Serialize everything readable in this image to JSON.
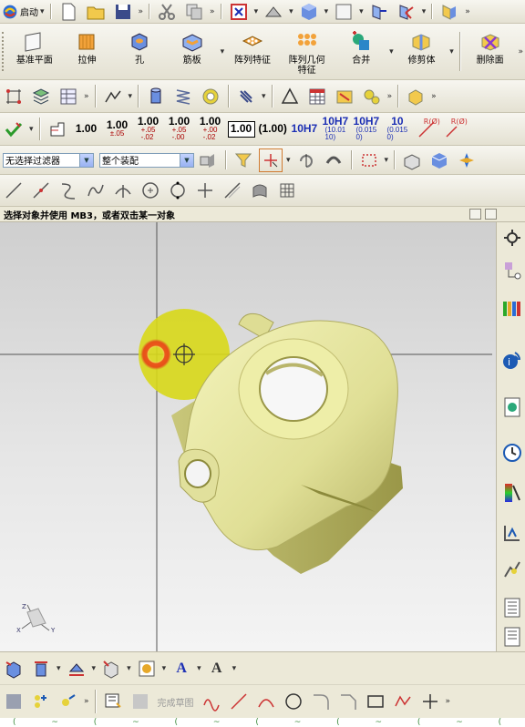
{
  "toolbar1": {
    "start_label": "启动"
  },
  "features": [
    {
      "id": "datum-plane",
      "label": "基准平面"
    },
    {
      "id": "extrude",
      "label": "拉伸"
    },
    {
      "id": "hole",
      "label": "孔"
    },
    {
      "id": "rib",
      "label": "筋板"
    },
    {
      "id": "pattern-feature",
      "label": "阵列特征"
    },
    {
      "id": "pattern-geometry",
      "label": "阵列几何\n特征"
    },
    {
      "id": "unite",
      "label": "合并"
    },
    {
      "id": "trim-body",
      "label": "修剪体"
    },
    {
      "id": "delete-face",
      "label": "删除面"
    }
  ],
  "dimension_row": {
    "items": [
      {
        "main": "1.00",
        "sub": ""
      },
      {
        "main": "1.00",
        "sub": "±.05"
      },
      {
        "main": "1.00",
        "sub": "+.05\n-.02"
      },
      {
        "main": "1.00",
        "sub": "+.05\n-.00"
      },
      {
        "main": "1.00",
        "sub": "+.00\n-.02"
      }
    ],
    "boxed": "1.00",
    "paren": "(1.00)",
    "fit1": "10H7",
    "fit2_main": "10H7",
    "fit2_sub": "(10.01\n10)",
    "fit3_main": "10H7",
    "fit3_sub": "(0.015\n0)",
    "fit4_main": "10",
    "fit4_sub": "(0.015\n0)",
    "r1": "R(Ø)",
    "r2": "R(Ø)"
  },
  "selection": {
    "filter_value": "无选择过滤器",
    "scope_value": "整个装配"
  },
  "status_text": "选择对象并使用 MB3，或者双击某一对象",
  "bottom": {
    "finish_sketch_label": "完成草图"
  },
  "colors": {
    "model": "#e4e49a",
    "model_shadow": "#8c8a3c",
    "highlight_disc": "#d8d818",
    "ring": "#e84a1a",
    "accent_blue": "#1c2fb4"
  },
  "footer_strip": "( ~ ( ~ ( ~ ( ~ ( ~ ( ~ ( ~ ( ~ ( ~ ( ~ ( ~ ( ~"
}
